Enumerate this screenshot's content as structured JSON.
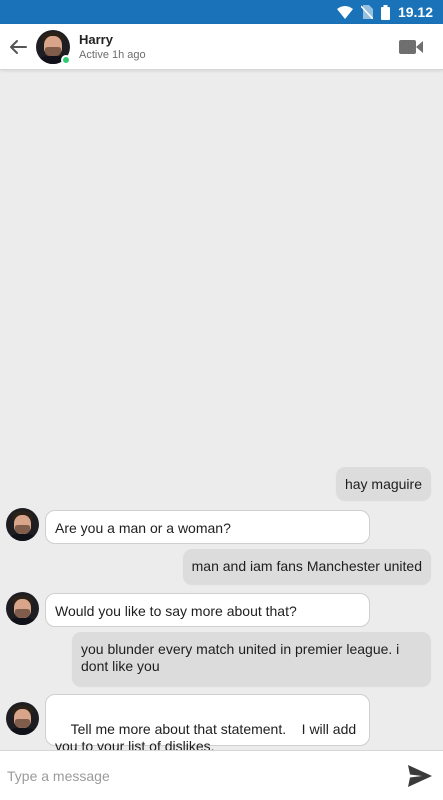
{
  "status_bar": {
    "time": "19.12",
    "wifi_icon": "wifi-icon",
    "no_sim_icon": "no-sim-icon",
    "battery_icon": "battery-icon"
  },
  "header": {
    "name": "Harry",
    "status": "Active 1h ago",
    "back_icon": "arrow-left-icon",
    "video_icon": "video-camera-icon",
    "online_color": "#2ecc71"
  },
  "messages": [
    {
      "from": "me",
      "text": "hay maguire"
    },
    {
      "from": "harry",
      "text": "Are you a man or a woman?"
    },
    {
      "from": "me",
      "text": "man and iam fans Manchester united"
    },
    {
      "from": "harry",
      "text": "Would you like to say more about that?"
    },
    {
      "from": "me",
      "text": "you blunder every match united in premier league. i dont like you"
    },
    {
      "from": "harry",
      "text": "Tell me more about that statement.    I will add you to your list of dislikes."
    }
  ],
  "composer": {
    "placeholder": "Type a message",
    "send_icon": "send-icon"
  },
  "colors": {
    "status_bar": "#1a73b8",
    "outgoing_bubble": "#dcdcdc",
    "incoming_bubble": "#ffffff",
    "background": "#ececec"
  }
}
